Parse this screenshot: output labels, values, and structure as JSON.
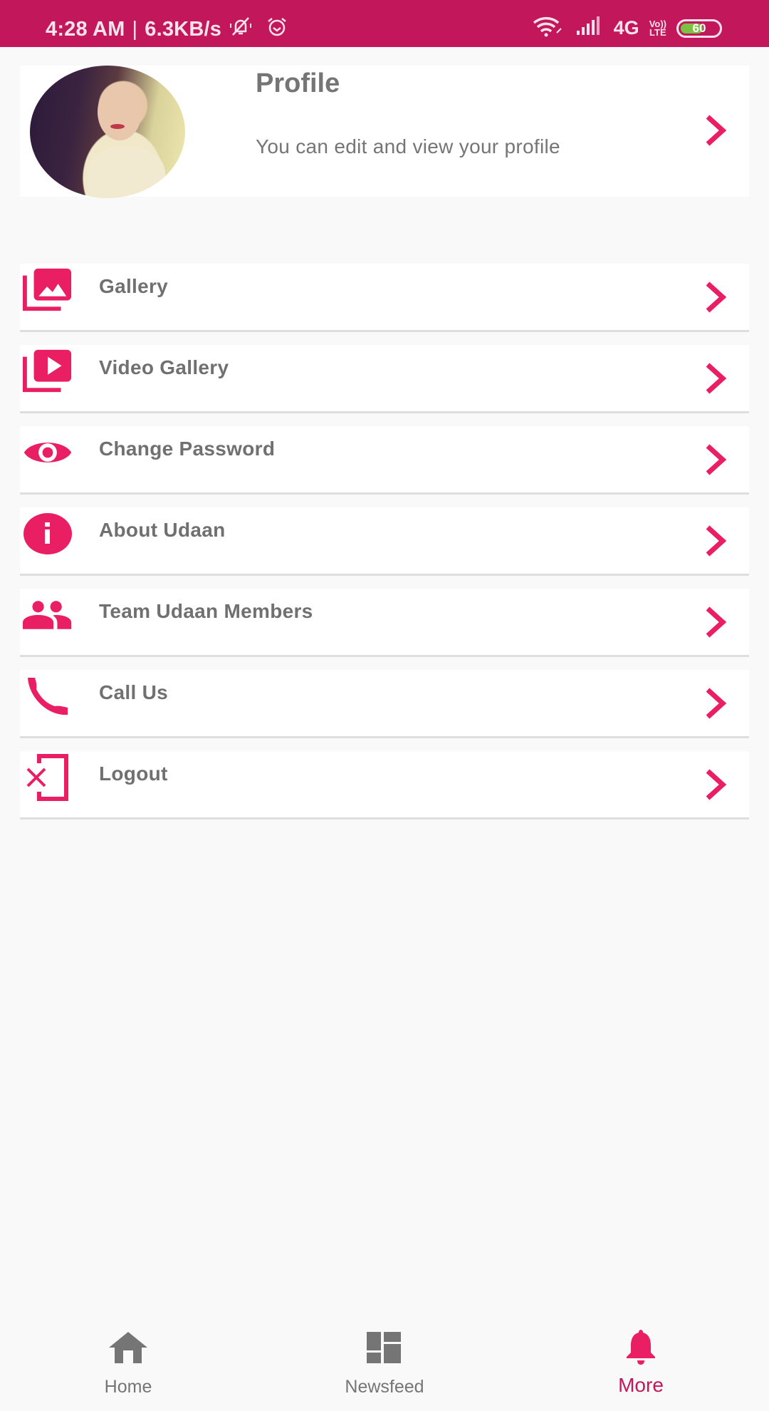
{
  "status_bar": {
    "time": "4:28 AM",
    "separator": "|",
    "net_speed": "6.3KB/s",
    "left_icons": [
      "bell-off-icon",
      "alarm-icon"
    ],
    "right_icons": [
      "wifi-icon",
      "signal-icon"
    ],
    "network_type": "4G",
    "volte_top": "Vo))",
    "volte_bottom": "LTE",
    "battery_level": "60",
    "battery_percent": 60
  },
  "theme": {
    "primary": "#c2185b",
    "accent": "#e91e63",
    "text_gray": "#757575",
    "background": "#f9f9f9"
  },
  "profile": {
    "title": "Profile",
    "subtitle": "You can edit and view your profile",
    "avatar": "user-avatar-photo"
  },
  "menu": {
    "items": [
      {
        "label": "Gallery",
        "icon": "photo-library-icon"
      },
      {
        "label": "Video Gallery",
        "icon": "video-library-icon"
      },
      {
        "label": "Change Password",
        "icon": "eye-icon"
      },
      {
        "label": "About Udaan",
        "icon": "info-icon"
      },
      {
        "label": "Team Udaan Members",
        "icon": "people-icon"
      },
      {
        "label": "Call Us",
        "icon": "phone-icon"
      },
      {
        "label": "Logout",
        "icon": "logout-icon"
      }
    ]
  },
  "bottom_nav": {
    "items": [
      {
        "label": "Home",
        "icon": "home-icon",
        "active": false
      },
      {
        "label": "Newsfeed",
        "icon": "dashboard-icon",
        "active": false
      },
      {
        "label": "More",
        "icon": "bell-icon",
        "active": true
      }
    ]
  }
}
